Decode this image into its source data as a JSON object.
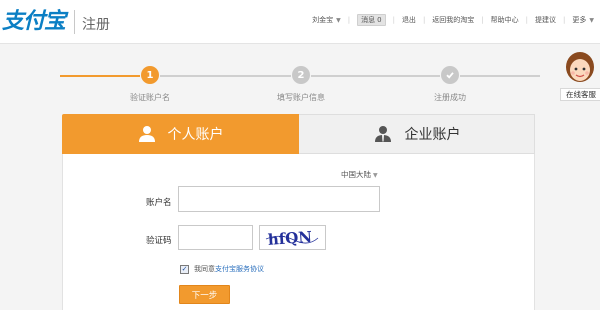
{
  "header": {
    "logo_text": "支付宝",
    "subtitle": "注册",
    "nav": {
      "user": "刘金宝",
      "messages_label": "消息",
      "messages_count": "0",
      "logout": "退出",
      "back_to_taobao": "返回我的淘宝",
      "help": "帮助中心",
      "suggest": "提建议",
      "more": "更多"
    }
  },
  "steps": [
    {
      "number": "1",
      "label": "验证账户名",
      "state": "active"
    },
    {
      "number": "2",
      "label": "填写账户信息",
      "state": "pending"
    },
    {
      "number": "",
      "label": "注册成功",
      "state": "pending"
    }
  ],
  "chat": {
    "label": "在线客服"
  },
  "tabs": {
    "personal": "个人账户",
    "company": "企业账户"
  },
  "form": {
    "region": "中国大陆",
    "account_label": "账户名",
    "account_value": "",
    "captcha_label": "验证码",
    "captcha_value": "",
    "captcha_image_text": "hfQN",
    "agree_text": "我同意",
    "agree_link": "支付宝服务协议",
    "agree_checked": true,
    "submit": "下一步"
  },
  "colors": {
    "accent": "#f29a2e",
    "brand": "#0b7fc4",
    "link": "#2a6fbd",
    "inactive": "#c8c8c8"
  }
}
